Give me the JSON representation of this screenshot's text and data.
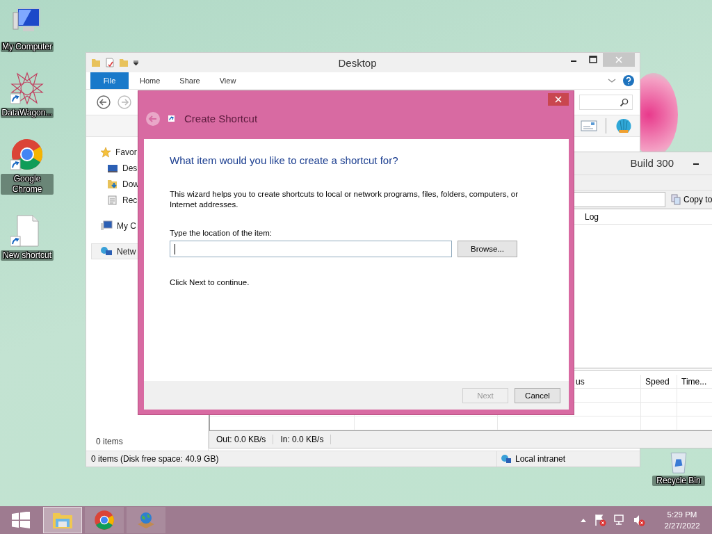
{
  "desktop_icons": [
    {
      "label": "My Computer",
      "kind": "computer",
      "shortcut": false
    },
    {
      "label": "DataWagon...",
      "kind": "star",
      "shortcut": true
    },
    {
      "label": "Google Chrome",
      "kind": "chrome",
      "shortcut": true
    },
    {
      "label": "New shortcut",
      "kind": "document",
      "shortcut": true
    }
  ],
  "recycle_bin": {
    "label": "Recycle Bin"
  },
  "explorer": {
    "title": "Desktop",
    "ribbon_tabs": [
      {
        "label": "File",
        "kind": "file"
      },
      {
        "label": "Home",
        "kind": "tab"
      },
      {
        "label": "Share",
        "kind": "tab"
      },
      {
        "label": "View",
        "kind": "tab"
      }
    ],
    "nav_items": [
      {
        "label": "Favor",
        "kind": "star",
        "selected": false,
        "indent": false
      },
      {
        "label": "Des",
        "kind": "desktop",
        "selected": false,
        "indent": true
      },
      {
        "label": "Dow",
        "kind": "downloads",
        "selected": false,
        "indent": true
      },
      {
        "label": "Rec",
        "kind": "recent",
        "selected": false,
        "indent": true
      },
      {
        "label": "My C",
        "kind": "computer",
        "selected": false,
        "indent": false
      },
      {
        "label": "Netw",
        "kind": "network",
        "selected": true,
        "indent": false
      }
    ],
    "item_count": "0 items",
    "status": "0 items (Disk free space: 40.9 GB)",
    "zone": "Local intranet"
  },
  "transfer_window": {
    "title": "Build 300",
    "copy_button": "Copy to",
    "top_columns": [
      "Log"
    ],
    "bottom_columns": [
      "us",
      "Speed",
      "Time..."
    ],
    "status": [
      "Out: 0.0 KB/s",
      "In: 0.0 KB/s"
    ]
  },
  "dialog": {
    "title": "Create Shortcut",
    "heading": "What item would you like to create a shortcut for?",
    "description": "This wizard helps you to create shortcuts to local or network programs, files, folders, computers, or Internet addresses.",
    "field_label": "Type the location of the item:",
    "browse_button": "Browse...",
    "hint": "Click Next to continue.",
    "buttons": [
      {
        "label": "Next",
        "disabled": true
      },
      {
        "label": "Cancel",
        "disabled": false
      }
    ]
  },
  "taskbar": {
    "apps": [
      {
        "kind": "explorer",
        "selected": true
      },
      {
        "kind": "chrome",
        "selected": false
      },
      {
        "kind": "globe",
        "selected": false
      }
    ],
    "time": "5:29 PM",
    "date": "2/27/2022"
  }
}
